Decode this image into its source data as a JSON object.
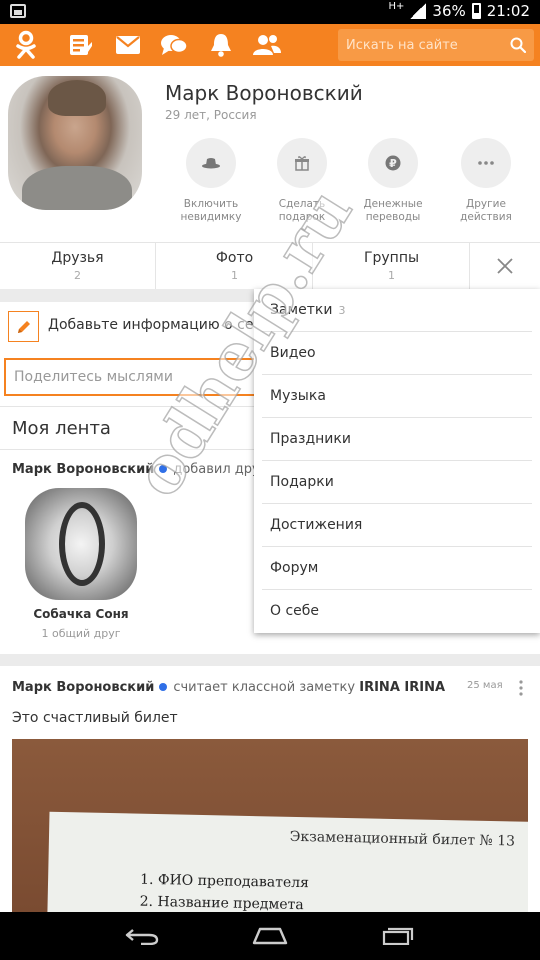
{
  "status_bar": {
    "network": "H+",
    "battery": "36%",
    "time": "21:02"
  },
  "toolbar": {
    "logo_icon": "odnoklassniki-logo-icon",
    "icons": [
      "notes-icon",
      "mail-icon",
      "chat-icon",
      "bell-icon",
      "friends-icon"
    ],
    "search_placeholder": "Искать на сайте",
    "accent": "#f58220"
  },
  "profile": {
    "name": "Марк Вороновский",
    "details": "29 лет, Россия",
    "actions": [
      {
        "label": "Включить невидимку",
        "icon": "hat-icon"
      },
      {
        "label": "Сделать подарок",
        "icon": "gift-icon"
      },
      {
        "label": "Денежные переводы",
        "icon": "ruble-icon"
      },
      {
        "label": "Другие действия",
        "icon": "more-icon"
      }
    ]
  },
  "tabs": [
    {
      "label": "Друзья",
      "count": "2"
    },
    {
      "label": "Фото",
      "count": "1"
    },
    {
      "label": "Группы",
      "count": "1"
    }
  ],
  "add_info": "Добавьте информацию о себе",
  "post_placeholder": "Поделитесь мыслями",
  "feed": {
    "title": "Моя лента",
    "item1": {
      "author": "Марк Вороновский",
      "action": "добавил друга",
      "friend_name": "Собачка Соня",
      "mutual": "1 общий друг"
    },
    "item2": {
      "author": "Марк Вороновский",
      "action": "считает классной заметку",
      "target": "IRINA IRINA",
      "date": "25 мая",
      "text": "Это счастливый билет",
      "photo_title": "Экзаменационный билет № 13",
      "photo_line1": "1.  ФИО преподавателя",
      "photo_line2": "2.  Название предмета"
    }
  },
  "menu": [
    {
      "label": "Заметки",
      "count": "3"
    },
    {
      "label": "Видео"
    },
    {
      "label": "Музыка"
    },
    {
      "label": "Праздники"
    },
    {
      "label": "Подарки"
    },
    {
      "label": "Достижения"
    },
    {
      "label": "Форум"
    },
    {
      "label": "О себе"
    }
  ],
  "watermark": "odhelp.ru"
}
